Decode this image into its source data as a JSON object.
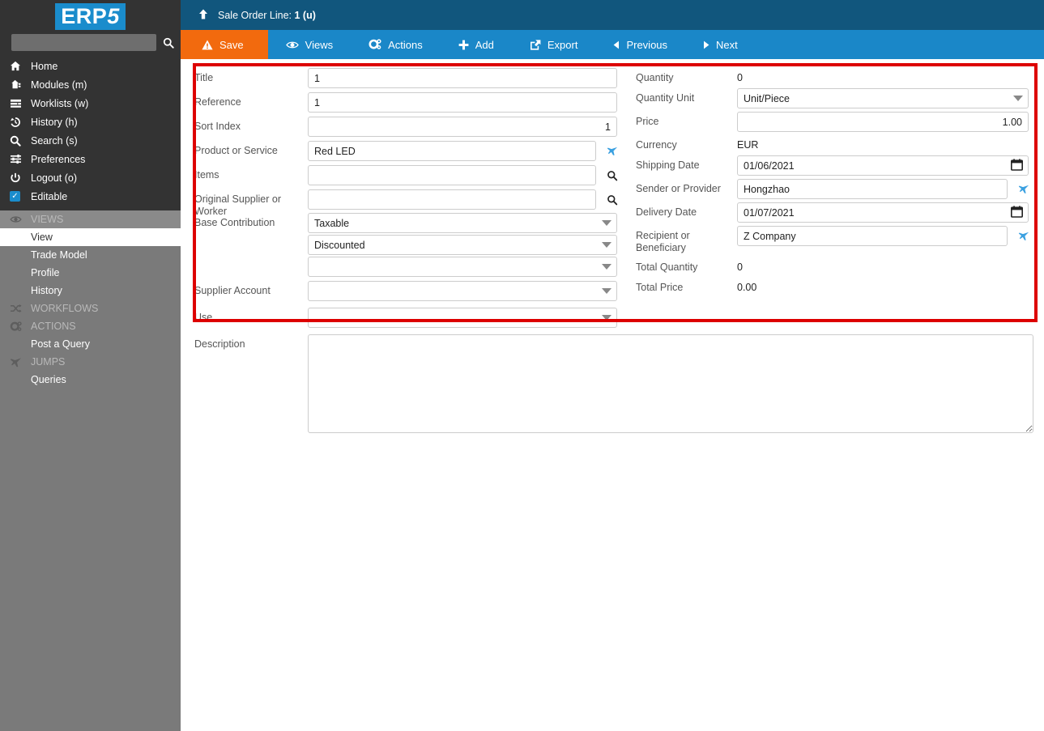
{
  "brand": {
    "logo_text": "ERP",
    "logo_suffix": "5"
  },
  "sidebar": {
    "search": {
      "value": "",
      "placeholder": ""
    },
    "nav": [
      {
        "label": "Home",
        "icon": "home-icon"
      },
      {
        "label": "Modules (m)",
        "icon": "modules-icon"
      },
      {
        "label": "Worklists (w)",
        "icon": "worklists-icon"
      },
      {
        "label": "History (h)",
        "icon": "history-icon"
      },
      {
        "label": "Search (s)",
        "icon": "search-icon"
      },
      {
        "label": "Preferences",
        "icon": "sliders-icon"
      },
      {
        "label": "Logout (o)",
        "icon": "power-icon"
      },
      {
        "label": "Editable",
        "icon": "checkbox-checked-icon"
      }
    ],
    "groups": [
      {
        "header": "VIEWS",
        "icon": "eye-icon",
        "highlighted": true,
        "items": [
          {
            "label": "View",
            "active": true
          },
          {
            "label": "Trade Model",
            "active": false
          },
          {
            "label": "Profile",
            "active": false
          },
          {
            "label": "History",
            "active": false
          }
        ]
      },
      {
        "header": "WORKFLOWS",
        "icon": "shuffle-icon",
        "highlighted": false,
        "items": []
      },
      {
        "header": "ACTIONS",
        "icon": "gear-icon",
        "highlighted": false,
        "items": [
          {
            "label": "Post a Query",
            "active": false
          }
        ]
      },
      {
        "header": "JUMPS",
        "icon": "plane-icon",
        "highlighted": false,
        "items": [
          {
            "label": "Queries",
            "active": false
          }
        ]
      }
    ]
  },
  "header": {
    "up_icon": "arrow-up-icon",
    "breadcrumb_prefix": "Sale Order Line: ",
    "breadcrumb_value": "1 (u)"
  },
  "toolbar": {
    "save_label": "Save",
    "views_label": "Views",
    "actions_label": "Actions",
    "add_label": "Add",
    "export_label": "Export",
    "previous_label": "Previous",
    "next_label": "Next"
  },
  "form": {
    "left": {
      "title_label": "Title",
      "title_value": "1",
      "reference_label": "Reference",
      "reference_value": "1",
      "sort_index_label": "Sort Index",
      "sort_index_value": "1",
      "product_or_service_label": "Product or Service",
      "product_or_service_value": "Red LED",
      "items_label": "Items",
      "items_value": "",
      "original_supplier_label": "Original Supplier or Worker",
      "original_supplier_value": "",
      "base_contribution_label": "Base Contribution",
      "base_contribution_1": "Taxable",
      "base_contribution_2": "Discounted",
      "base_contribution_3": "",
      "supplier_account_label": "Supplier Account",
      "supplier_account_value": "",
      "use_label": "Use",
      "use_value": "",
      "description_label": "Description",
      "description_value": ""
    },
    "right": {
      "quantity_label": "Quantity",
      "quantity_value": "0",
      "quantity_unit_label": "Quantity Unit",
      "quantity_unit_value": "Unit/Piece",
      "price_label": "Price",
      "price_value": "1.00",
      "currency_label": "Currency",
      "currency_value": "EUR",
      "shipping_date_label": "Shipping Date",
      "shipping_date_value": "01/06/2021",
      "sender_or_provider_label": "Sender or Provider",
      "sender_or_provider_value": "Hongzhao",
      "delivery_date_label": "Delivery Date",
      "delivery_date_value": "01/07/2021",
      "recipient_label": "Recipient or Beneficiary",
      "recipient_value": "Z Company",
      "total_quantity_label": "Total Quantity",
      "total_quantity_value": "0",
      "total_price_label": "Total Price",
      "total_price_value": "0.00"
    }
  },
  "colors": {
    "sidebar_top": "#333333",
    "sidebar_bottom": "#7a7a7a",
    "breadcrumb_bar": "#11567d",
    "toolbar": "#1a87c8",
    "save_accent": "#f26a0e",
    "brand_blue": "#1a8ccc",
    "annotation_red": "#dd0000"
  }
}
